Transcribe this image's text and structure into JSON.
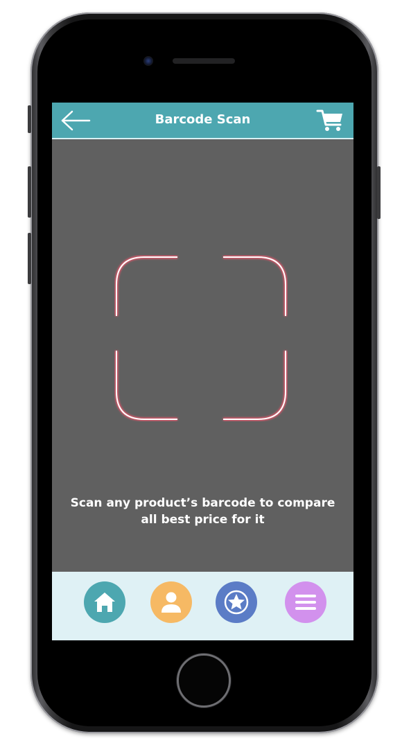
{
  "header": {
    "title": "Barcode Scan"
  },
  "scan": {
    "instruction": "Scan any product’s barcode to compare all best price for it"
  },
  "icons": {
    "back": "arrow-left-icon",
    "cart": "shopping-cart-icon",
    "home": "home-icon",
    "profile": "user-icon",
    "favorites": "star-icon",
    "menu": "hamburger-menu-icon"
  },
  "colors": {
    "header": "#4da7b0",
    "screen_background": "#606060",
    "scan_frame": "#e0566a",
    "nav_background": "#dff1f5",
    "nav_home": "#4da7b0",
    "nav_profile": "#f6b964",
    "nav_favorites": "#5b7cc6",
    "nav_menu": "#d291ed"
  }
}
